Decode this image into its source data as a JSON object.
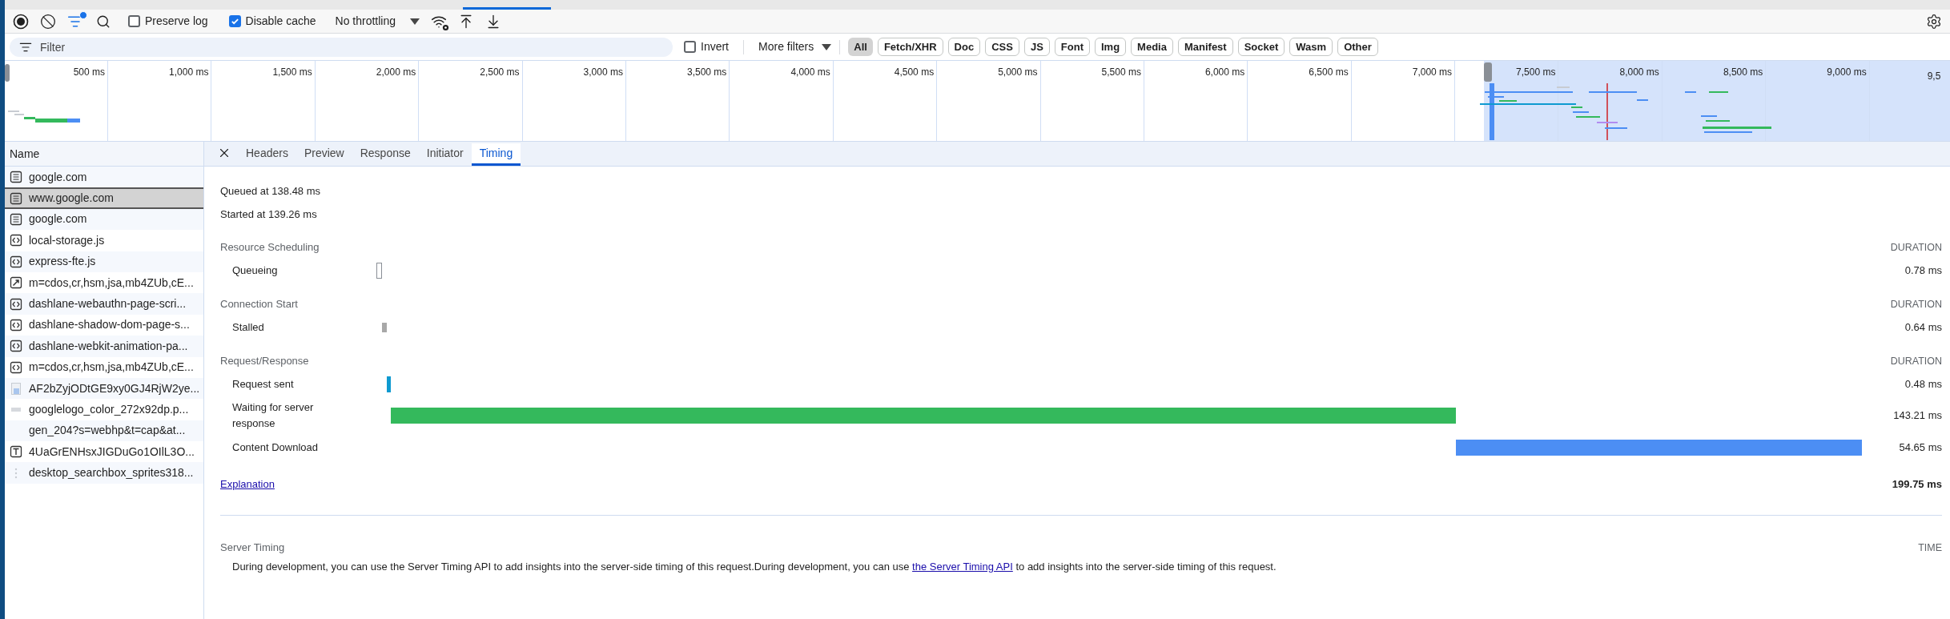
{
  "toolbar": {
    "preserve_log": {
      "label": "Preserve log",
      "checked": false
    },
    "disable_cache": {
      "label": "Disable cache",
      "checked": true
    },
    "throttling": "No throttling"
  },
  "filter_bar": {
    "placeholder": "Filter",
    "invert": {
      "label": "Invert",
      "checked": false
    },
    "more_filters": "More filters",
    "types": [
      {
        "label": "All",
        "selected": true
      },
      {
        "label": "Fetch/XHR",
        "selected": false
      },
      {
        "label": "Doc",
        "selected": false
      },
      {
        "label": "CSS",
        "selected": false
      },
      {
        "label": "JS",
        "selected": false
      },
      {
        "label": "Font",
        "selected": false
      },
      {
        "label": "Img",
        "selected": false
      },
      {
        "label": "Media",
        "selected": false
      },
      {
        "label": "Manifest",
        "selected": false
      },
      {
        "label": "Socket",
        "selected": false
      },
      {
        "label": "Wasm",
        "selected": false
      },
      {
        "label": "Other",
        "selected": false
      }
    ]
  },
  "overview": {
    "ticks": [
      "500 ms",
      "1,000 ms",
      "1,500 ms",
      "2,000 ms",
      "2,500 ms",
      "3,000 ms",
      "3,500 ms",
      "4,000 ms",
      "4,500 ms",
      "5,000 ms",
      "5,500 ms",
      "6,000 ms",
      "6,500 ms",
      "7,000 ms",
      "7,500 ms",
      "8,000 ms",
      "8,500 ms",
      "9,000 ms",
      "9,5"
    ]
  },
  "request_list": {
    "header": "Name",
    "rows": [
      {
        "name": "google.com",
        "kind": "document",
        "selected": false
      },
      {
        "name": "www.google.com",
        "kind": "document",
        "selected": true
      },
      {
        "name": "google.com",
        "kind": "document",
        "selected": false
      },
      {
        "name": "local-storage.js",
        "kind": "script",
        "selected": false
      },
      {
        "name": "express-fte.js",
        "kind": "script",
        "selected": false
      },
      {
        "name": "m=cdos,cr,hsm,jsa,mb4ZUb,cE...",
        "kind": "other",
        "selected": false
      },
      {
        "name": "dashlane-webauthn-page-scri...",
        "kind": "script",
        "selected": false
      },
      {
        "name": "dashlane-shadow-dom-page-s...",
        "kind": "script",
        "selected": false
      },
      {
        "name": "dashlane-webkit-animation-pa...",
        "kind": "script",
        "selected": false
      },
      {
        "name": "m=cdos,cr,hsm,jsa,mb4ZUb,cE...",
        "kind": "script",
        "selected": false
      },
      {
        "name": "AF2bZyjODtGE9xy0GJ4RjW2ye...",
        "kind": "image",
        "selected": false
      },
      {
        "name": "googlelogo_color_272x92dp.p...",
        "kind": "thumbnail",
        "selected": false
      },
      {
        "name": "gen_204?s=webhp&t=cap&at...",
        "kind": "ping",
        "selected": false
      },
      {
        "name": "4UaGrENHsxJIGDuGo1OIlL3O...",
        "kind": "font",
        "selected": false
      },
      {
        "name": "desktop_searchbox_sprites318...",
        "kind": "sprite",
        "selected": false
      }
    ]
  },
  "details": {
    "tabs": [
      {
        "label": "Headers",
        "selected": false
      },
      {
        "label": "Preview",
        "selected": false
      },
      {
        "label": "Response",
        "selected": false
      },
      {
        "label": "Initiator",
        "selected": false
      },
      {
        "label": "Timing",
        "selected": true
      }
    ],
    "timing": {
      "queued": "Queued at 138.48 ms",
      "started": "Started at 139.26 ms",
      "sections": [
        {
          "title": "Resource Scheduling",
          "column": "DURATION",
          "phases": [
            {
              "label": "Queueing",
              "kind": "outline",
              "duration": "0.78 ms"
            }
          ]
        },
        {
          "title": "Connection Start",
          "column": "DURATION",
          "phases": [
            {
              "label": "Stalled",
              "kind": "bar",
              "color": "#a8a8a8",
              "duration": "0.64 ms"
            }
          ]
        },
        {
          "title": "Request/Response",
          "column": "DURATION",
          "phases": [
            {
              "label": "Request sent",
              "kind": "bar",
              "color": "#0e9ad0",
              "duration": "0.48 ms"
            },
            {
              "label": "Waiting for server response",
              "kind": "bar",
              "color": "#34b95c",
              "duration": "143.21 ms"
            },
            {
              "label": "Content Download",
              "kind": "bar",
              "color": "#4c8ef4",
              "duration": "54.65 ms"
            }
          ]
        }
      ],
      "explanation": "Explanation",
      "total": "199.75 ms",
      "server_timing": {
        "title": "Server Timing",
        "column": "TIME",
        "text_before": "During development, you can use the Server Timing API to add insights into the server-side timing of this request.During development, you can use ",
        "link": "the Server Timing API",
        "text_after": " to add insights into the server-side timing of this request."
      }
    }
  }
}
